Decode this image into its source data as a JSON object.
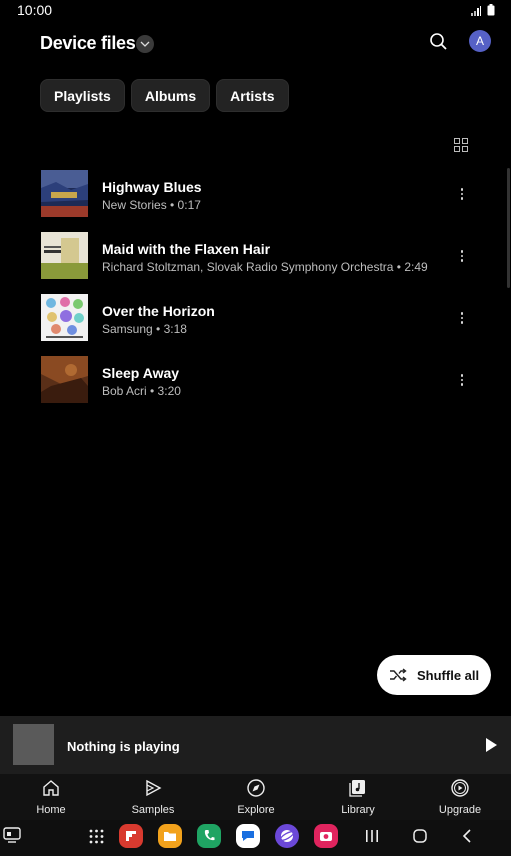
{
  "status": {
    "time": "10:00"
  },
  "header": {
    "title": "Device files"
  },
  "chips": [
    "Playlists",
    "Albums",
    "Artists"
  ],
  "avatar_letter": "A",
  "tracks": [
    {
      "title": "Highway Blues",
      "subtitle": "New Stories • 0:17"
    },
    {
      "title": "Maid with the Flaxen Hair",
      "subtitle": "Richard Stoltzman, Slovak Radio Symphony Orchestra • 2:49"
    },
    {
      "title": "Over the Horizon",
      "subtitle": "Samsung • 3:18"
    },
    {
      "title": "Sleep Away",
      "subtitle": "Bob Acri • 3:20"
    }
  ],
  "shuffle_label": "Shuffle all",
  "mini_player": {
    "text": "Nothing is playing"
  },
  "nav": [
    "Home",
    "Samples",
    "Explore",
    "Library",
    "Upgrade"
  ],
  "colors": {
    "background": "#000000",
    "chip": "#232323",
    "avatar": "#5661c6",
    "mini_player": "#1e1e1e"
  },
  "dock_apps": [
    "apps-grid-icon",
    "flipboard-icon",
    "my-files-icon",
    "phone-icon",
    "messages-icon",
    "internet-icon",
    "camera-icon"
  ]
}
